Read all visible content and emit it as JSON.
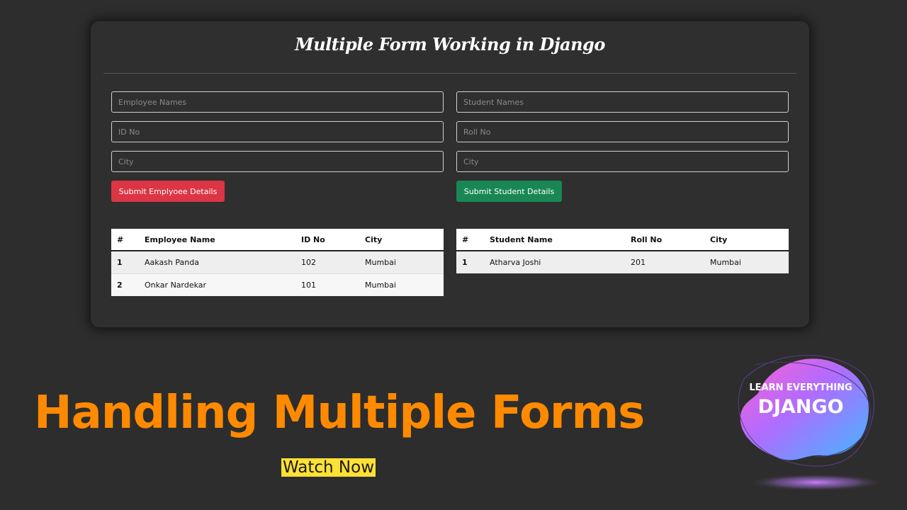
{
  "card": {
    "title": "Multiple Form Working in Django"
  },
  "employee_form": {
    "name_placeholder": "Employee Names",
    "id_placeholder": "ID No",
    "city_placeholder": "City",
    "submit_label": "Submit Emplyoee Details"
  },
  "student_form": {
    "name_placeholder": "Student Names",
    "roll_placeholder": "Roll No",
    "city_placeholder": "City",
    "submit_label": "Submit Student Details"
  },
  "employee_table": {
    "headers": [
      "#",
      "Employee Name",
      "ID No",
      "City"
    ],
    "rows": [
      [
        "1",
        "Aakash Panda",
        "102",
        "Mumbai"
      ],
      [
        "2",
        "Onkar Nardekar",
        "101",
        "Mumbai"
      ]
    ]
  },
  "student_table": {
    "headers": [
      "#",
      "Student Name",
      "Roll No",
      "City"
    ],
    "rows": [
      [
        "1",
        "Atharva Joshi",
        "201",
        "Mumbai"
      ]
    ]
  },
  "thumbnail": {
    "headline": "Handling Multiple Forms",
    "watch_label": "Watch Now",
    "badge_line1": "LEARN EVERYTHING",
    "badge_line2": "DJANGO"
  },
  "colors": {
    "page_bg": "#2d2d2d",
    "card_bg": "#2f2f2f",
    "danger": "#dc3545",
    "success": "#198754",
    "headline": "#ff8a00",
    "highlight": "#ffe135"
  }
}
